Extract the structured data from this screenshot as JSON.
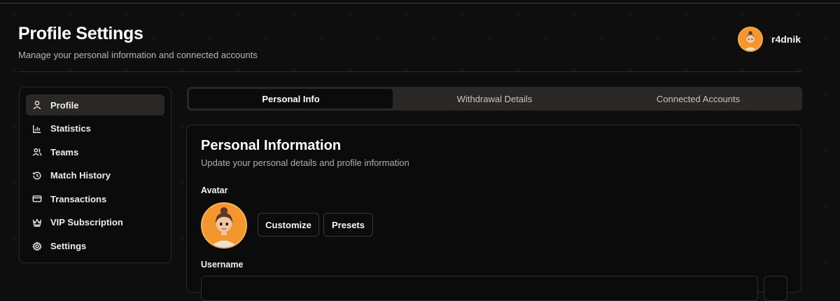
{
  "header": {
    "title": "Profile Settings",
    "subtitle": "Manage your personal information and connected accounts"
  },
  "user": {
    "name": "r4dnik",
    "avatar_icon": "cartoon-avatar-icon",
    "avatar_color": "#f2962d"
  },
  "sidebar": {
    "items": [
      {
        "label": "Profile",
        "icon": "user-icon",
        "active": true
      },
      {
        "label": "Statistics",
        "icon": "bar-chart-icon",
        "active": false
      },
      {
        "label": "Teams",
        "icon": "users-icon",
        "active": false
      },
      {
        "label": "Match History",
        "icon": "history-icon",
        "active": false
      },
      {
        "label": "Transactions",
        "icon": "credit-card-icon",
        "active": false
      },
      {
        "label": "VIP Subscription",
        "icon": "crown-icon",
        "active": false
      },
      {
        "label": "Settings",
        "icon": "gear-icon",
        "active": false
      }
    ]
  },
  "tabs": [
    {
      "label": "Personal Info",
      "active": true
    },
    {
      "label": "Withdrawal Details",
      "active": false
    },
    {
      "label": "Connected Accounts",
      "active": false
    }
  ],
  "personal_info": {
    "title": "Personal Information",
    "subtitle": "Update your personal details and profile information",
    "avatar_label": "Avatar",
    "customize_label": "Customize",
    "presets_label": "Presets",
    "username_label": "Username",
    "username_value": ""
  },
  "colors": {
    "background": "#0f0e0e",
    "panel": "#0c0b0b",
    "active_item": "#2a2727",
    "avatar_orange": "#f2962d"
  }
}
